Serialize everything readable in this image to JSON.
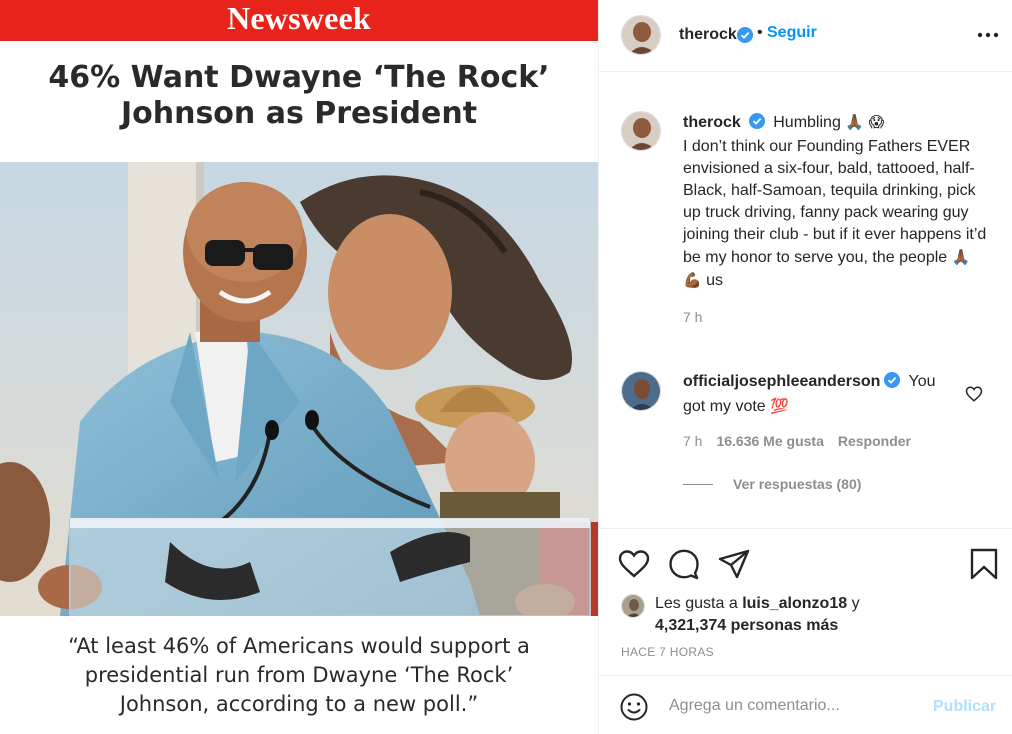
{
  "post_image": {
    "brand": "Newsweek",
    "headline_line1": "46% Want Dwayne ‘The Rock’",
    "headline_line2": "Johnson as President",
    "quote_line1": "“At least 46% of Americans would support a",
    "quote_line2": "presidential run from Dwayne ‘The Rock’",
    "quote_line3": "Johnson, according to a new poll.”",
    "colors": {
      "brand_red": "#e8231c",
      "headline": "#2a2a2a"
    }
  },
  "header": {
    "username": "therock",
    "separator": "•",
    "follow_label": "Seguir",
    "more_icon": "more-horizontal-icon"
  },
  "caption": {
    "username": "therock",
    "text_start": "Humbling",
    "emoji_1": "🙏🏾",
    "emoji_2": "😱",
    "body": "I don’t think our Founding Fathers EVER envisioned a six-four, bald, tattooed, half-Black, half-Samoan, tequila drinking, pick up truck driving, fanny pack wearing guy joining their club - but if it ever happens it’d be my honor to serve you, the people",
    "emoji_3": "🙏🏾",
    "emoji_4": "💪🏾",
    "body_end": "us",
    "time": "7 h"
  },
  "comment": {
    "username": "officialjosephleeanderson",
    "text": "You got my vote",
    "emoji": "💯",
    "time": "7 h",
    "likes": "16.636 Me gusta",
    "reply_label": "Responder",
    "view_replies": "Ver respuestas (80)"
  },
  "actions": {
    "icons": [
      "heart-icon",
      "comment-icon",
      "share-icon",
      "bookmark-icon"
    ],
    "likes_prefix": "Les gusta a",
    "likes_user": "luis_alonzo18",
    "likes_suffix": "y",
    "likes_count": "4,321,374 personas más",
    "timestamp": "HACE 7 HORAS"
  },
  "comment_bar": {
    "placeholder": "Agrega un comentario...",
    "publish_label": "Publicar",
    "emoji_icon": "smiley-icon"
  },
  "colors": {
    "link_blue": "#0095f6",
    "publish_disabled": "#b2dffc",
    "muted": "#8e8e8e",
    "verified": "#3897f0"
  }
}
